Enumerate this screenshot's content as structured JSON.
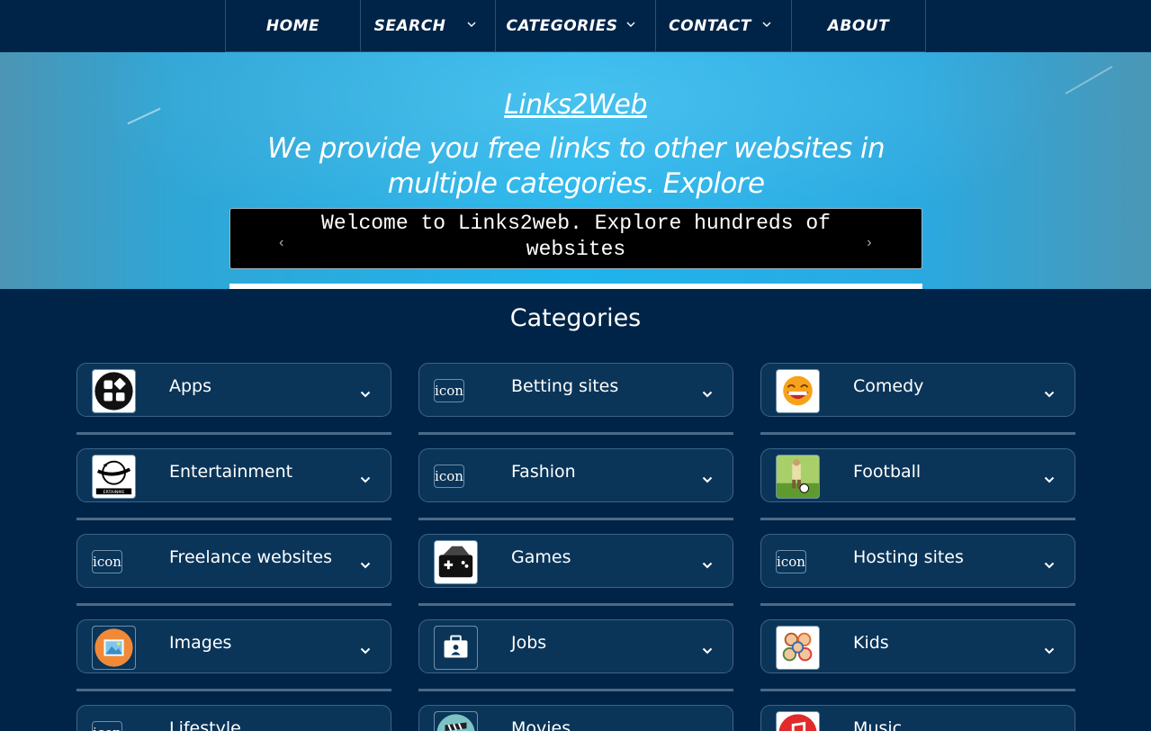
{
  "nav": {
    "items": [
      {
        "label": "HOME",
        "has_dropdown": false
      },
      {
        "label": "SEARCH",
        "has_dropdown": true
      },
      {
        "label": "CATEGORIES",
        "has_dropdown": true
      },
      {
        "label": "CONTACT",
        "has_dropdown": true
      },
      {
        "label": "ABOUT",
        "has_dropdown": false
      }
    ]
  },
  "hero": {
    "title": "Links2Web",
    "tagline": "We provide you free links to other websites in multiple categories. Explore",
    "ticker_text": "Welcome to Links2web. Explore hundreds of websites",
    "prev_glyph": "‹",
    "next_glyph": "›"
  },
  "categories": {
    "heading": "Categories",
    "placeholder_icon_text": "icon",
    "items": [
      {
        "label": "Apps",
        "icon": "apps-icon"
      },
      {
        "label": "Betting sites",
        "icon": "broken-image-icon"
      },
      {
        "label": "Comedy",
        "icon": "laughing-face-icon"
      },
      {
        "label": "Entertainment",
        "icon": "entertainment-logo-icon"
      },
      {
        "label": "Fashion",
        "icon": "broken-image-icon"
      },
      {
        "label": "Football",
        "icon": "football-field-icon"
      },
      {
        "label": "Freelance websites",
        "icon": "broken-image-icon"
      },
      {
        "label": "Games",
        "icon": "gamepad-icon"
      },
      {
        "label": "Hosting sites",
        "icon": "broken-image-icon"
      },
      {
        "label": "Images",
        "icon": "image-icon"
      },
      {
        "label": "Jobs",
        "icon": "briefcase-icon"
      },
      {
        "label": "Kids",
        "icon": "kids-icon"
      },
      {
        "label": "Lifestyle",
        "icon": "broken-image-icon"
      },
      {
        "label": "Movies",
        "icon": "clapperboard-icon"
      },
      {
        "label": "Music",
        "icon": "music-note-icon"
      }
    ]
  },
  "colors": {
    "page_bg": "#002447",
    "card_bg": "#0a3559",
    "hero_blue": "#1fb4ec"
  }
}
